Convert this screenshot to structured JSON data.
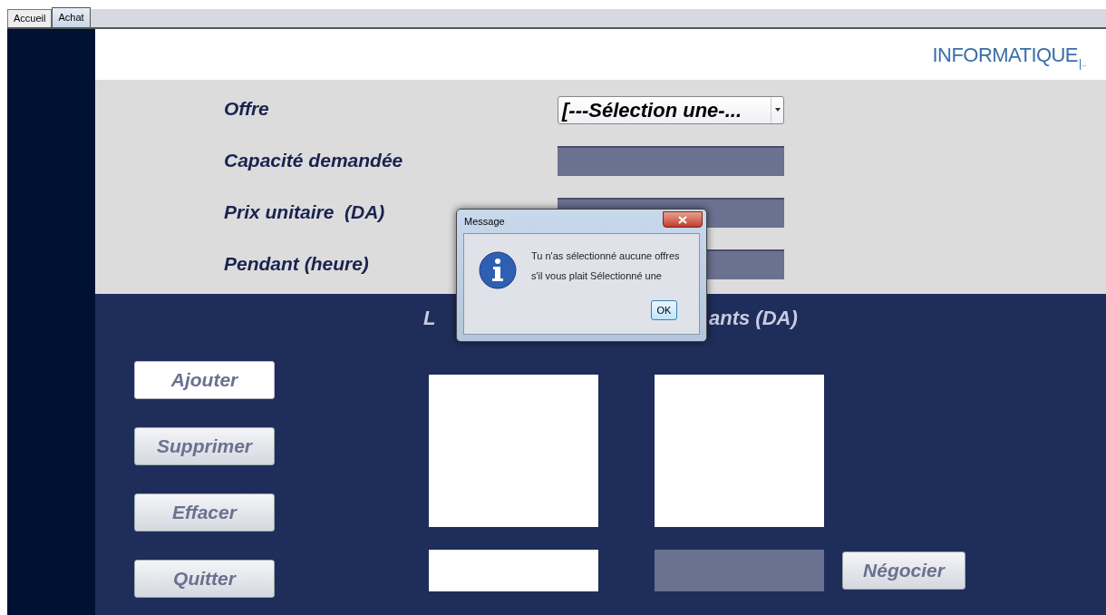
{
  "tabs": [
    {
      "label": "Accueil",
      "selected": false
    },
    {
      "label": "Achat",
      "selected": true
    }
  ],
  "logo": {
    "text": "INFORMATIQUE",
    "suffix": "..."
  },
  "form": {
    "fields": [
      {
        "kind": "combo",
        "label": "Offre",
        "value": "[---Sélection une-..."
      },
      {
        "kind": "text",
        "label": "Capacité demandée"
      },
      {
        "kind": "text",
        "label": "Prix unitaire  (DA)"
      },
      {
        "kind": "text",
        "label": "Pendant (heure)"
      }
    ]
  },
  "heading_fragments": [
    "L",
    "ants (DA)"
  ],
  "buttons": [
    {
      "label": "Ajouter",
      "focused": true
    },
    {
      "label": "Supprimer",
      "focused": false
    },
    {
      "label": "Effacer",
      "focused": false
    },
    {
      "label": "Quitter",
      "focused": false
    }
  ],
  "negotiate_button": {
    "label": "Négocier"
  },
  "dialog": {
    "title": "Message",
    "lines": [
      "Tu n'as sélectionné aucune offres",
      "s'il vous plait Sélectionné une"
    ],
    "button": "OK"
  }
}
